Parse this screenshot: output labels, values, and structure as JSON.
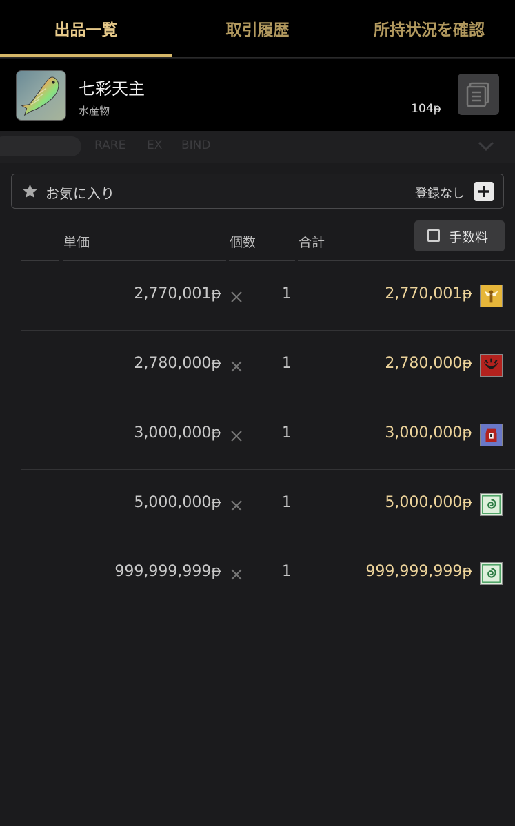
{
  "tabs": [
    {
      "label": "出品一覧",
      "active": true
    },
    {
      "label": "取引履歴",
      "active": false
    },
    {
      "label": "所持状況を確認",
      "active": false
    }
  ],
  "item": {
    "name": "七彩天主",
    "category": "水産物",
    "price": "104ᵽ",
    "icon": "rainbow-fish-icon"
  },
  "filter": {
    "tags": [
      "RARE",
      "EX",
      "BIND"
    ]
  },
  "favorites": {
    "label": "お気に入り",
    "status": "登録なし"
  },
  "columns": {
    "unit_price": "単価",
    "quantity": "個数",
    "total": "合計",
    "fee_label": "手数料"
  },
  "listings": [
    {
      "unit_price": "2,770,001ᵽ",
      "quantity": "1",
      "total": "2,770,001ᵽ",
      "crest": "gold-eagle-crest"
    },
    {
      "unit_price": "2,780,000ᵽ",
      "quantity": "1",
      "total": "2,780,000ᵽ",
      "crest": "red-serpent-crest"
    },
    {
      "unit_price": "3,000,000ᵽ",
      "quantity": "1",
      "total": "3,000,000ᵽ",
      "crest": "blue-flame-crest"
    },
    {
      "unit_price": "5,000,000ᵽ",
      "quantity": "1",
      "total": "5,000,000ᵽ",
      "crest": "green-swirl-crest"
    },
    {
      "unit_price": "999,999,999ᵽ",
      "quantity": "1",
      "total": "999,999,999ᵽ",
      "crest": "green-swirl-crest"
    }
  ],
  "colors": {
    "accent_gold": "#d6b769",
    "total_gold": "#ecd39a",
    "background": "#1b1b1d"
  }
}
